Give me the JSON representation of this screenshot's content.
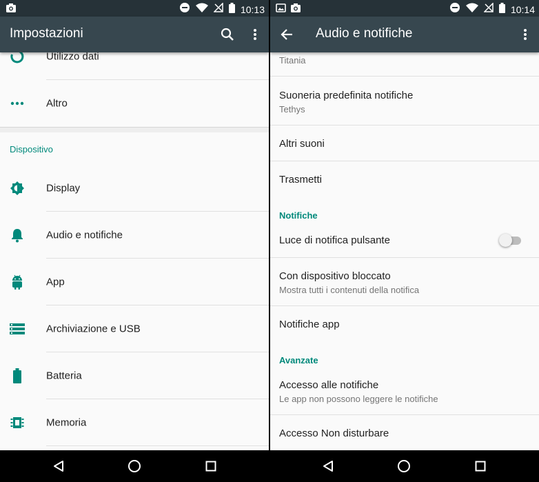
{
  "colors": {
    "accent": "#00897b",
    "appbar": "#37474f",
    "statusbar": "#263238",
    "background": "#fafafa"
  },
  "left": {
    "statusbar": {
      "time": "10:13",
      "icons": [
        "camera-notification-icon",
        "dnd-minus-icon",
        "wifi-icon",
        "no-signal-icon",
        "battery-icon"
      ]
    },
    "appbar": {
      "title": "Impostazioni",
      "icons": [
        "search-icon",
        "overflow-menu-icon"
      ]
    },
    "items_top": [
      {
        "label": "Utilizzo dati",
        "icon": "data-usage-icon"
      },
      {
        "label": "Altro",
        "icon": "more-dots-icon"
      }
    ],
    "section": "Dispositivo",
    "items": [
      {
        "label": "Display",
        "icon": "brightness-icon"
      },
      {
        "label": "Audio e notifiche",
        "icon": "bell-icon"
      },
      {
        "label": "App",
        "icon": "android-icon"
      },
      {
        "label": "Archiviazione e USB",
        "icon": "storage-icon"
      },
      {
        "label": "Batteria",
        "icon": "battery-icon"
      },
      {
        "label": "Memoria",
        "icon": "memory-icon"
      }
    ]
  },
  "right": {
    "statusbar": {
      "time": "10:14",
      "icons": [
        "image-notification-icon",
        "camera-notification-icon",
        "dnd-minus-icon",
        "wifi-icon",
        "no-signal-icon",
        "battery-icon"
      ]
    },
    "appbar": {
      "title": "Audio e notifiche",
      "icons": [
        "back-arrow-icon",
        "overflow-menu-icon"
      ]
    },
    "ringtone_partial": {
      "summary": "Titania"
    },
    "notification_ringtone": {
      "title": "Suoneria predefinita notifiche",
      "summary": "Tethys"
    },
    "other_sounds": {
      "title": "Altri suoni"
    },
    "cast": {
      "title": "Trasmetti"
    },
    "section_notifications": "Notifiche",
    "pulse_light": {
      "title": "Luce di notifica pulsante",
      "checked": false
    },
    "lock_screen": {
      "title": "Con dispositivo bloccato",
      "summary": "Mostra tutti i contenuti della notifica"
    },
    "app_notifications": {
      "title": "Notifiche app"
    },
    "section_advanced": "Avanzate",
    "notification_access": {
      "title": "Accesso alle notifiche",
      "summary": "Le app non possono leggere le notifiche"
    },
    "dnd_access": {
      "title": "Accesso Non disturbare"
    }
  },
  "navbar": {
    "buttons": [
      "back-triangle-icon",
      "home-circle-icon",
      "recents-square-icon"
    ]
  }
}
